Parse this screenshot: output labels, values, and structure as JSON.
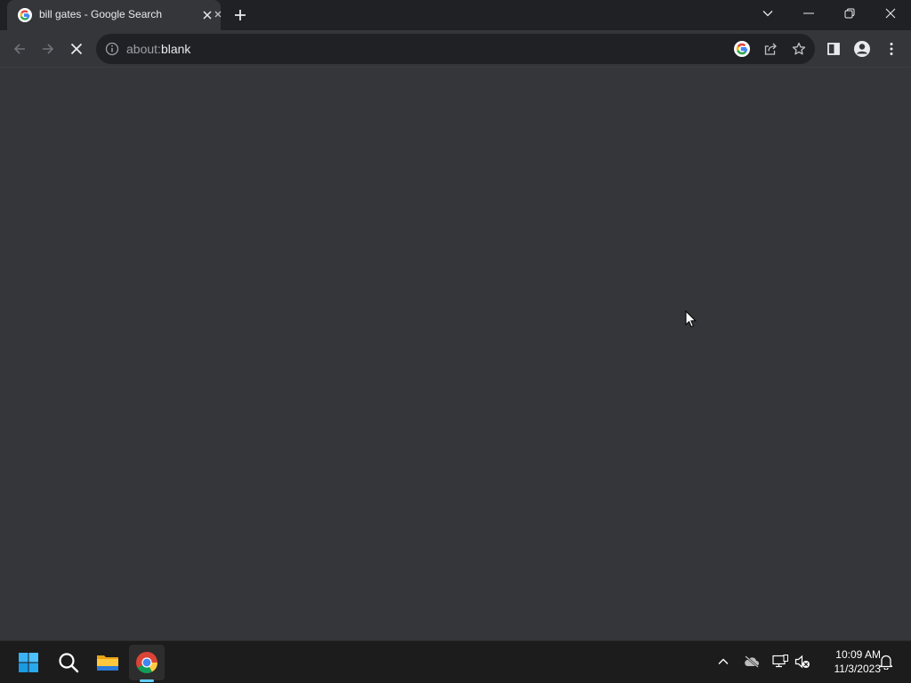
{
  "browser": {
    "tab": {
      "title": "bill gates - Google Search",
      "favicon": "google-g-icon",
      "close_icon": "close-icon"
    },
    "new_tab_icon": "plus-icon",
    "window_controls": {
      "tab_search": "chevron-down-icon",
      "minimize": "minimize-icon",
      "restore": "restore-icon",
      "close": "close-icon"
    },
    "toolbar": {
      "back": "arrow-left-icon",
      "forward": "arrow-right-icon",
      "stop": "stop-loading-icon",
      "address": {
        "scheme": "about:",
        "host": "blank",
        "info_icon": "info-icon"
      },
      "google_lens": "google-g-icon",
      "share": "share-icon",
      "bookmark": "star-icon",
      "side_panel": "side-panel-icon",
      "profile": "profile-icon",
      "menu": "kebab-menu-icon"
    }
  },
  "taskbar": {
    "apps": [
      "windows-start-icon",
      "search-icon",
      "file-explorer-icon",
      "chrome-icon"
    ],
    "tray": [
      "chevron-up-icon",
      "onedrive-offline-icon",
      "network-icon",
      "volume-muted-icon"
    ],
    "clock": {
      "time": "10:09 AM",
      "date": "11/3/2023"
    },
    "notifications_icon": "bell-icon"
  },
  "colors": {
    "titlebar": "#202124",
    "toolbar": "#35363a",
    "omnibox": "#202124",
    "taskbar": "#1c1c1c",
    "accent": "#60cdff"
  }
}
